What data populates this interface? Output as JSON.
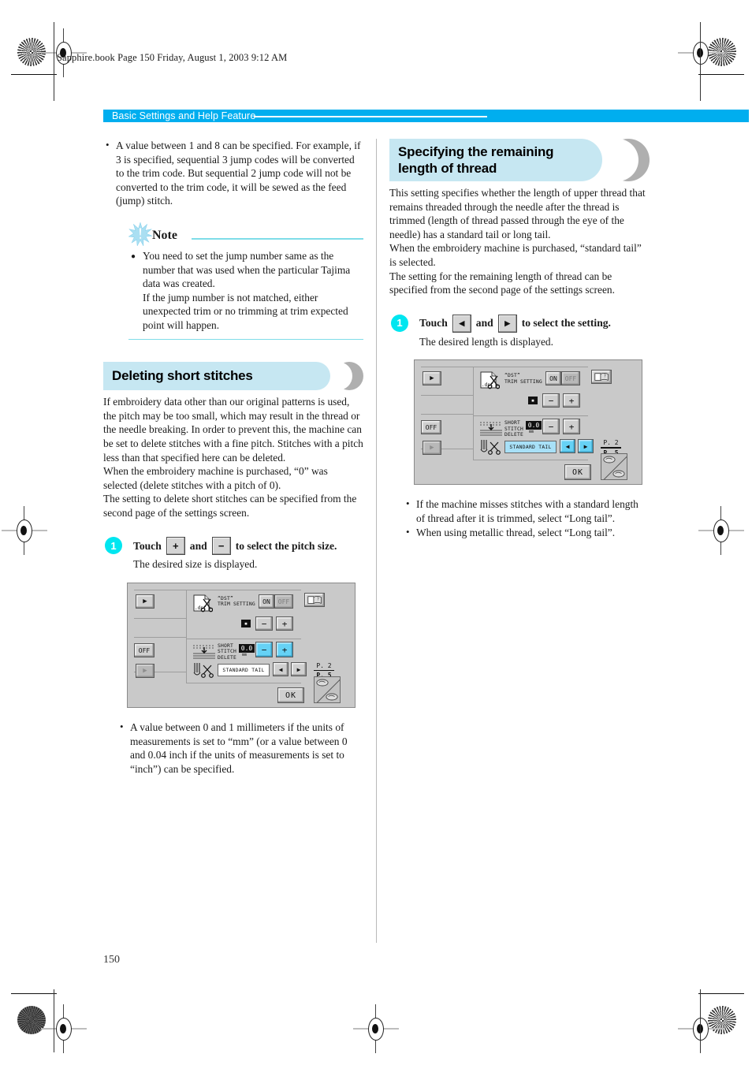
{
  "print_header": {
    "text": "Sapphire.book  Page 150  Friday, August 1, 2003  9:12 AM"
  },
  "running_head": {
    "label": "Basic Settings and Help Feature",
    "bar_color": "#00AEEF"
  },
  "folio": "150",
  "left_column": {
    "intro_bullets": [
      "A value between 1 and 8 can be specified. For example, if 3 is specified, sequential 3 jump codes will be converted to the trim code. But sequential 2 jump code will not be converted to the trim code, it will be sewed as the feed (jump) stitch."
    ],
    "note": {
      "title": "Note",
      "icon": "starburst-icon",
      "rule_color": "#7FDDE8",
      "items": [
        "You need to set the jump number same as the number that was used when the particular Tajima data was created.\nIf the jump number is not matched, either unexpected trim or no trimming at trim expected point will happen."
      ]
    },
    "section": {
      "heading": "Deleting short stitches",
      "heading_bg": "#C6E7F2",
      "body": "If embroidery data other than our original patterns is used, the pitch may be too small, which may result in the thread or the needle breaking. In order to prevent this, the machine can be set to delete stitches with a fine pitch. Stitches with a pitch less than that specified here can be deleted.\nWhen the embroidery machine is purchased, “0” was selected (delete stitches with a pitch of 0).\nThe setting to delete short stitches can be specified from the second page of the settings screen."
    },
    "step": {
      "number": "1",
      "title_part1": "Touch",
      "key1": "+",
      "title_part2": "and",
      "key2": "−",
      "title_part3": "to select the pitch size.",
      "subtitle": "The desired size is displayed."
    },
    "trailing_bullets": [
      "A value between 0 and 1 millimeters if the units of measurements is set to “mm” (or a value between 0 and 0.04 inch if the units of measurements is set to “inch”) can be specified."
    ]
  },
  "right_column": {
    "section": {
      "heading_line1": "Specifying the remaining",
      "heading_line2": "length of thread",
      "heading_bg": "#C6E7F2",
      "body": "This setting specifies whether the length of upper thread that remains threaded through the needle after the thread is trimmed (length of thread passed through the eye of the needle) has a standard tail or long tail.\nWhen the embroidery machine is purchased, “standard tail” is selected.\nThe setting for the remaining length of thread can be specified from the second page of the settings screen."
    },
    "step": {
      "number": "1",
      "title_part1": "Touch",
      "key1": "◀",
      "title_part2": "and",
      "key2": "▶",
      "title_part3": "to select the setting.",
      "subtitle": "The desired length is displayed."
    },
    "trailing_bullets": [
      "If the machine misses stitches with a standard length of thread after it is trimmed, select “Long tail”.",
      "When using metallic thread, select “Long tail”."
    ]
  },
  "lcd_left": {
    "nav_top_arrow": "▶",
    "nav_off": "OFF",
    "nav_bottom_arrow": "▶",
    "help_icon": "manual-help-icon",
    "row1": {
      "icon": "dst-file-scissors-icon",
      "label": "“DST”\nTRIM SETTING",
      "toggle_on": "ON",
      "toggle_off": "OFF",
      "toggle_selected": "ON"
    },
    "row2": {
      "value_icon": "jump-count-icon",
      "minus": "−",
      "plus": "+",
      "highlight": "none"
    },
    "row3": {
      "icon": "short-stitch-icon",
      "label": "SHORT\nSTITCH\nDELETE",
      "digits": "0.0",
      "unit": "mm",
      "minus": "−",
      "plus": "+",
      "highlight": "both"
    },
    "row4": {
      "icon": "needle-scissors-icon",
      "value": "STANDARD TAIL",
      "left_arrow": "◀",
      "right_arrow": "▶",
      "highlight": "none"
    },
    "page_indicator_top": "P. 2",
    "page_indicator_bottom": "P. 5",
    "ok_button": "OK",
    "corner_icon": "page-flip-icon"
  },
  "lcd_right": {
    "nav_top_arrow": "▶",
    "nav_off": "OFF",
    "nav_bottom_arrow": "▶",
    "help_icon": "manual-help-icon",
    "row1": {
      "icon": "dst-file-scissors-icon",
      "label": "“DST”\nTRIM SETTING",
      "toggle_on": "ON",
      "toggle_off": "OFF",
      "toggle_selected": "ON"
    },
    "row2": {
      "value_icon": "jump-count-icon",
      "minus": "−",
      "plus": "+",
      "highlight": "none"
    },
    "row3": {
      "icon": "short-stitch-icon",
      "label": "SHORT\nSTITCH\nDELETE",
      "digits": "0.0",
      "unit": "mm",
      "minus": "−",
      "plus": "+",
      "highlight": "none"
    },
    "row4": {
      "icon": "needle-scissors-icon",
      "value": "STANDARD TAIL",
      "left_arrow": "◀",
      "right_arrow": "▶",
      "highlight": "both"
    },
    "page_indicator_top": "P. 2",
    "page_indicator_bottom": "P. 5",
    "ok_button": "OK",
    "corner_icon": "page-flip-icon"
  }
}
